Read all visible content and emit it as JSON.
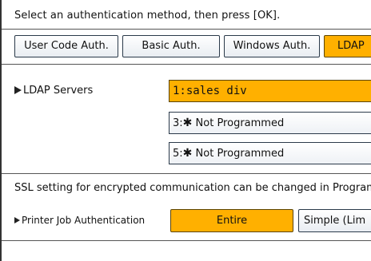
{
  "instruction": "Select an authentication method, then press [OK].",
  "auth_tabs": [
    {
      "label": "User Code Auth.",
      "selected": false
    },
    {
      "label": "Basic Auth.",
      "selected": false
    },
    {
      "label": "Windows Auth.",
      "selected": false
    },
    {
      "label": "LDAP",
      "selected": true
    }
  ],
  "ldap_servers": {
    "label": "LDAP Servers",
    "items": [
      {
        "number": "1:",
        "name": "sales div",
        "selected": true
      },
      {
        "number": "3:",
        "marker": "✱",
        "name": "Not Programmed",
        "selected": false
      },
      {
        "number": "5:",
        "marker": "✱",
        "name": "Not Programmed",
        "selected": false
      }
    ]
  },
  "ssl_note": "SSL setting for encrypted communication can be changed in Program",
  "printer_job_auth": {
    "label": "Printer Job Authentication",
    "options": [
      {
        "label": "Entire",
        "selected": true
      },
      {
        "label": "Simple (Lim",
        "selected": false
      }
    ]
  },
  "colors": {
    "accent": "#ffb000",
    "border": "#2b3a4a"
  }
}
